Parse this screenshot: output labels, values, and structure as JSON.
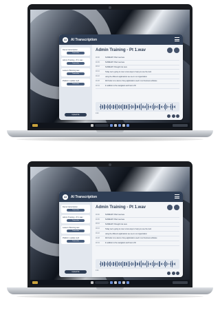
{
  "app": {
    "title": "AI Transcription",
    "logo_text": "AI"
  },
  "sidebar": {
    "files": [
      {
        "name": "Demo transcription",
        "button": "Transcribe"
      },
      {
        "name": "Admin Training - Pt 1.wav",
        "button": "Transcribe"
      },
      {
        "name": "Lesson Planning.wav",
        "button": "Transcribe"
      },
      {
        "name": "Platform update.mp3",
        "button": "Transcribe"
      }
    ],
    "new_button": "Upload file"
  },
  "main": {
    "title": "Admin Training - Pt 1.wav",
    "lines": [
      {
        "time": "00:00",
        "text": "SUMMARY: Brief overview"
      },
      {
        "time": "00:05",
        "text": "SUMMARY: Brief overview"
      },
      {
        "time": "00:10",
        "text": "SUMMARY: Brought into view"
      },
      {
        "time": "00:16",
        "text": "Today we're going to cover a few ways to help you use the tools"
      },
      {
        "time": "00:22",
        "text": "using the different applications we use in our organization"
      },
      {
        "time": "00:28",
        "text": "We'll also run a demo of key applications used in our business software"
      },
      {
        "time": "00:34",
        "text": "In addition to the navigation and how to fill"
      }
    ],
    "player": {
      "current_time": "0:00"
    }
  },
  "colors": {
    "accent": "#2f3e55",
    "button": "#4a5f7e",
    "window_bg": "#f3f5f8"
  }
}
